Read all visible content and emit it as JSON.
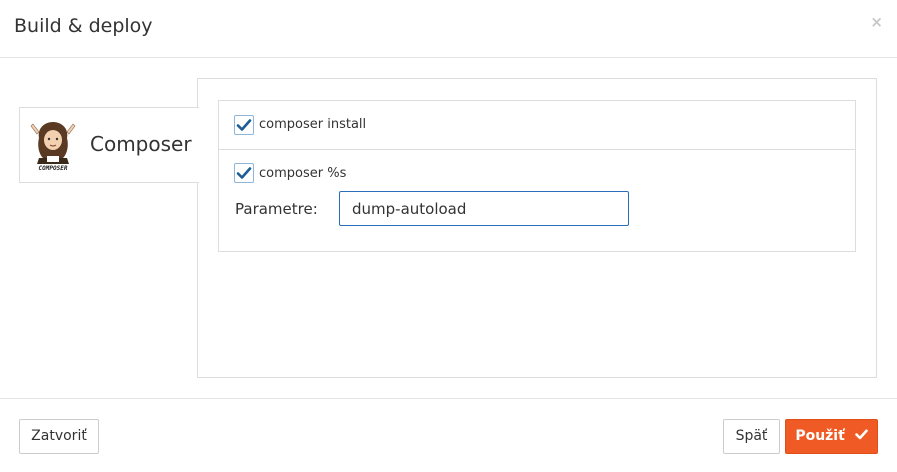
{
  "modal": {
    "title": "Build & deploy",
    "close_symbol": "×"
  },
  "tool": {
    "name": "Composer",
    "logo_icon": "composer-logo-icon",
    "logo_text": "COMPOSER"
  },
  "options": [
    {
      "label": "composer install",
      "checked": true
    },
    {
      "label": "composer %s",
      "checked": true
    }
  ],
  "parameter": {
    "label": "Parametre:",
    "value": "dump-autoload"
  },
  "footer": {
    "close_label": "Zatvoriť",
    "back_label": "Späť",
    "apply_label": "Použiť",
    "apply_icon": "check-icon"
  },
  "colors": {
    "accent": "#f05a24",
    "checkbox_check": "#1f5d96",
    "input_border": "#2a6ebb"
  }
}
